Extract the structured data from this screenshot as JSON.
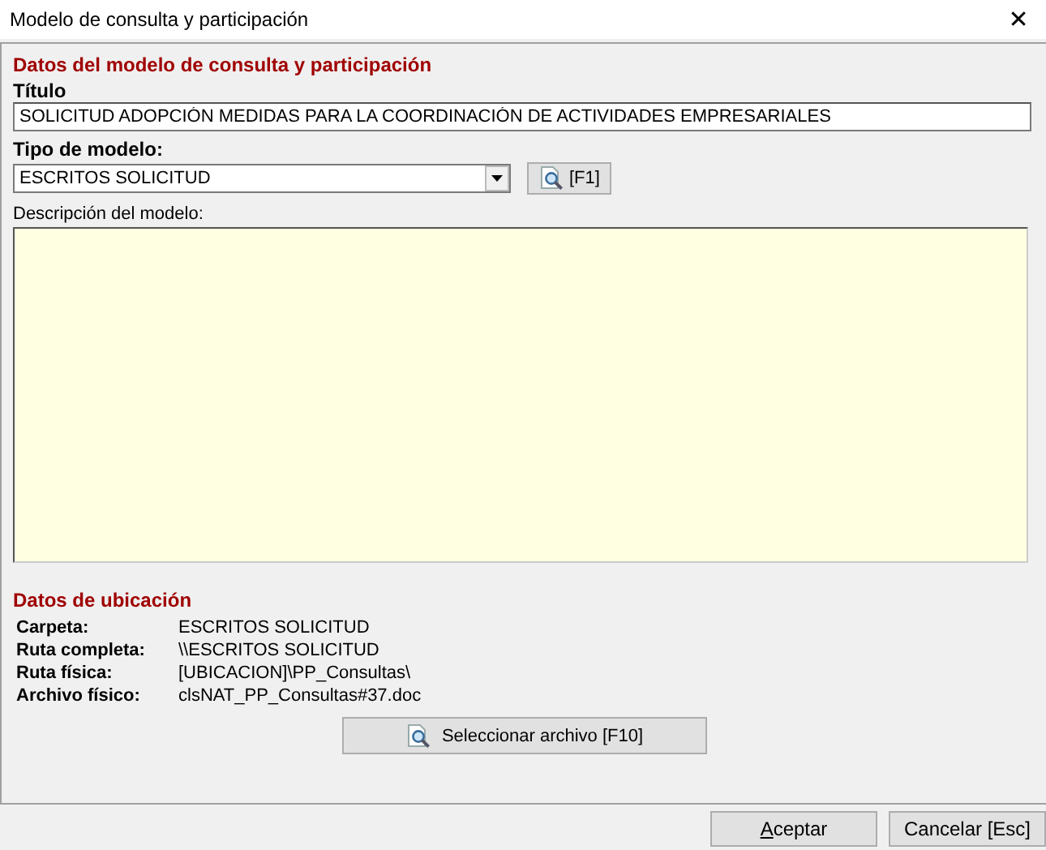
{
  "window": {
    "title": "Modelo de consulta y participación",
    "close_label": "✕"
  },
  "model_section": {
    "heading": "Datos del modelo de consulta y participación",
    "title_field": {
      "label": "Título",
      "value": "SOLICITUD ADOPCIÓN MEDIDAS PARA LA COORDINACIÓN DE ACTIVIDADES EMPRESARIALES"
    },
    "type_field": {
      "label": "Tipo de modelo:",
      "value": "ESCRITOS SOLICITUD",
      "lookup_button": "[F1]"
    },
    "description_field": {
      "label": "Descripción del modelo:"
    }
  },
  "location_section": {
    "heading": "Datos de ubicación",
    "rows": [
      {
        "label": "Carpeta:",
        "value": "ESCRITOS SOLICITUD"
      },
      {
        "label": "Ruta completa:",
        "value": "\\\\ESCRITOS SOLICITUD"
      },
      {
        "label": "Ruta física:",
        "value": "[UBICACION]\\PP_Consultas\\"
      },
      {
        "label": "Archivo físico:",
        "value": "clsNAT_PP_Consultas#37.doc"
      }
    ],
    "select_button": "Seleccionar archivo  [F10]"
  },
  "buttons": [
    {
      "label": "Aceptar",
      "first_letter_underlined": true
    },
    {
      "label": "Cancelar  [Esc]",
      "first_letter_underlined": false
    }
  ]
}
